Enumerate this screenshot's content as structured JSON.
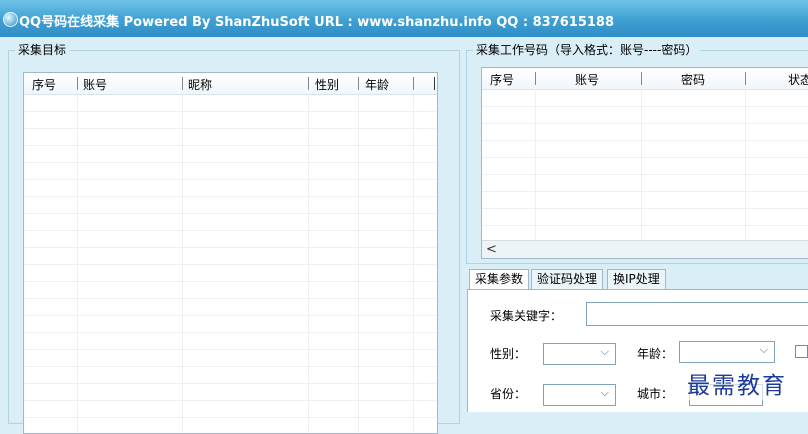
{
  "window": {
    "title": "QQ号码在线采集  Powered By ShanZhuSoft   URL : www.shanzhu.info   QQ : 837615188"
  },
  "targets": {
    "legend": "采集目标",
    "columns": [
      "序号",
      "账号",
      "昵称",
      "性别",
      "年龄"
    ]
  },
  "work_accounts": {
    "legend": "采集工作号码（导入格式：账号----密码）",
    "columns": [
      "序号",
      "账号",
      "密码",
      "状态"
    ],
    "scroll_left": "<"
  },
  "tabs": [
    {
      "label": "采集参数",
      "active": true
    },
    {
      "label": "验证码处理",
      "active": false
    },
    {
      "label": "换IP处理",
      "active": false
    }
  ],
  "params": {
    "keyword_label": "采集关键字：",
    "keyword_value": "",
    "gender_label": "性别：",
    "gender_value": "",
    "age_label": "年龄：",
    "age_value": "",
    "province_label": "省份：",
    "province_value": "",
    "city_label": "城市：",
    "city_value": ""
  },
  "watermark": "最需教育"
}
